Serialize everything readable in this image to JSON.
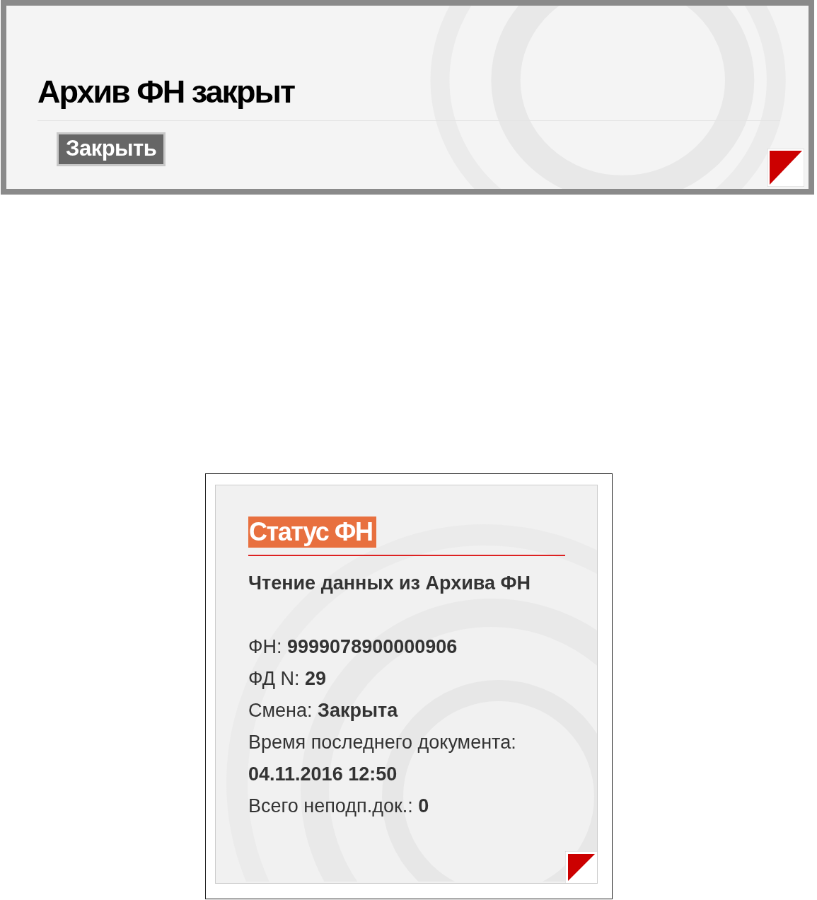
{
  "dialog": {
    "title": "Архив ФН закрыт",
    "buttons": [
      "Закрыть"
    ]
  },
  "status_card": {
    "heading": "Статус ФН",
    "subtitle": "Чтение данных из Архива ФН",
    "lines": [
      {
        "kind": "text",
        "text": "ФН: **9999078900000906**"
      },
      {
        "kind": "text",
        "text": "ФД N: **29**"
      },
      {
        "kind": "text",
        "text": "Смена: **Закрыта**"
      },
      {
        "kind": "text",
        "text": "Время последнего документа:"
      },
      {
        "kind": "value",
        "text": "04.11.2016 12:50"
      },
      {
        "kind": "text",
        "text": "Всего неподп.док.: **0**"
      }
    ]
  }
}
